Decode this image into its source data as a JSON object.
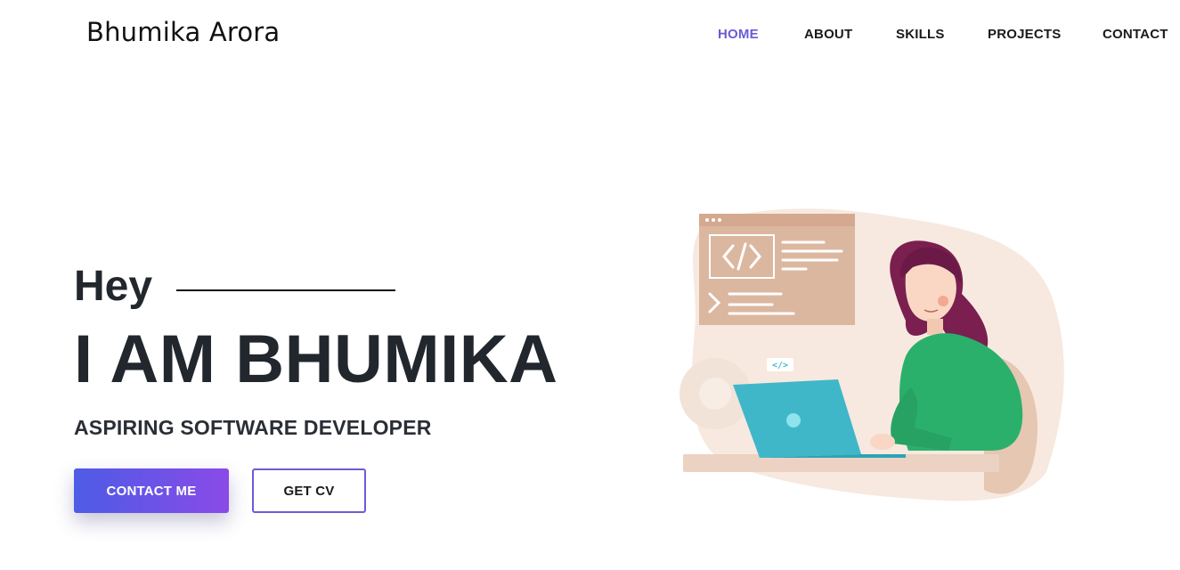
{
  "header": {
    "brand": "Bhumika Arora",
    "nav": [
      {
        "label": "HOME",
        "active": true
      },
      {
        "label": "ABOUT",
        "active": false
      },
      {
        "label": "SKILLS",
        "active": false
      },
      {
        "label": "PROJECTS",
        "active": false
      },
      {
        "label": "CONTACT",
        "active": false
      }
    ]
  },
  "hero": {
    "greeting": "Hey",
    "name": "I AM BHUMIKA",
    "role": "ASPIRING SOFTWARE DEVELOPER",
    "primary_button": "CONTACT ME",
    "secondary_button": "GET CV",
    "illustration_code_tag": "</>"
  },
  "colors": {
    "accent": "#6a5bd6",
    "button_gradient_start": "#4d5ce6",
    "button_gradient_end": "#8a4ae8",
    "text_dark": "#22272e"
  },
  "icons": {
    "illustration": "developer-at-laptop-illustration"
  }
}
